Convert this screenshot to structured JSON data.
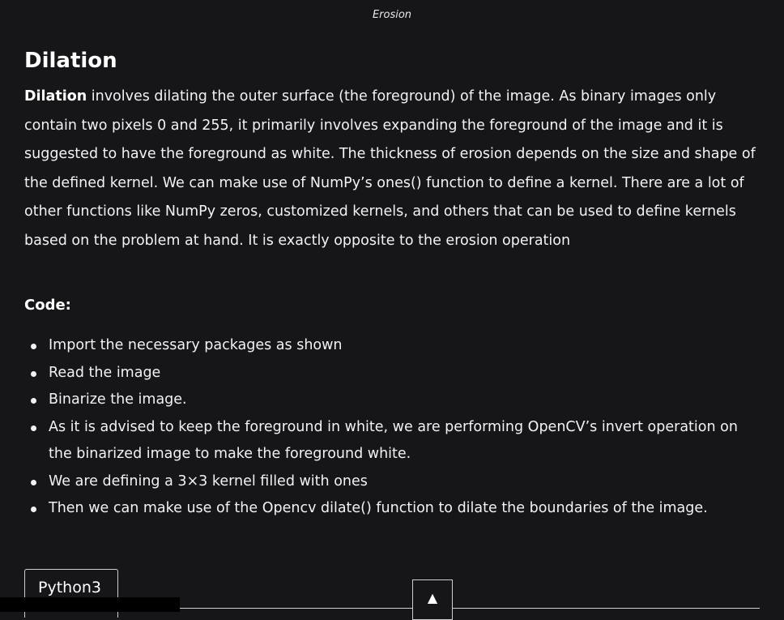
{
  "caption": "Erosion",
  "section": {
    "title": "Dilation",
    "intro_bold": "Dilation",
    "intro_text": " involves dilating the outer surface (the foreground) of the image. As binary images only contain two pixels 0 and 255, it primarily involves expanding the foreground of the image and it is suggested to have the foreground as white. The thickness of erosion depends on the size and shape of the defined kernel. We can make use of NumPy’s ones() function to define a kernel. There are a lot of other functions like NumPy zeros, customized kernels, and others that can be used to define kernels based on the problem at hand. It is exactly opposite to the erosion operation"
  },
  "code_section": {
    "heading": "Code:",
    "steps": [
      "Import the necessary packages as shown",
      "Read the image",
      "Binarize the image.",
      "As it is advised to keep the foreground in white, we are performing OpenCV’s invert operation on the binarized image to make the foreground white.",
      "We are defining a 3×3 kernel filled with ones",
      "Then we can make use of the Opencv dilate() function to dilate the boundaries of the image."
    ]
  },
  "code_block": {
    "language_tab": "Python3"
  },
  "scroll_top": {
    "icon": "▲",
    "icon_name": "arrow-up-icon"
  },
  "colors": {
    "background": "#161619",
    "text": "#ffffff"
  }
}
